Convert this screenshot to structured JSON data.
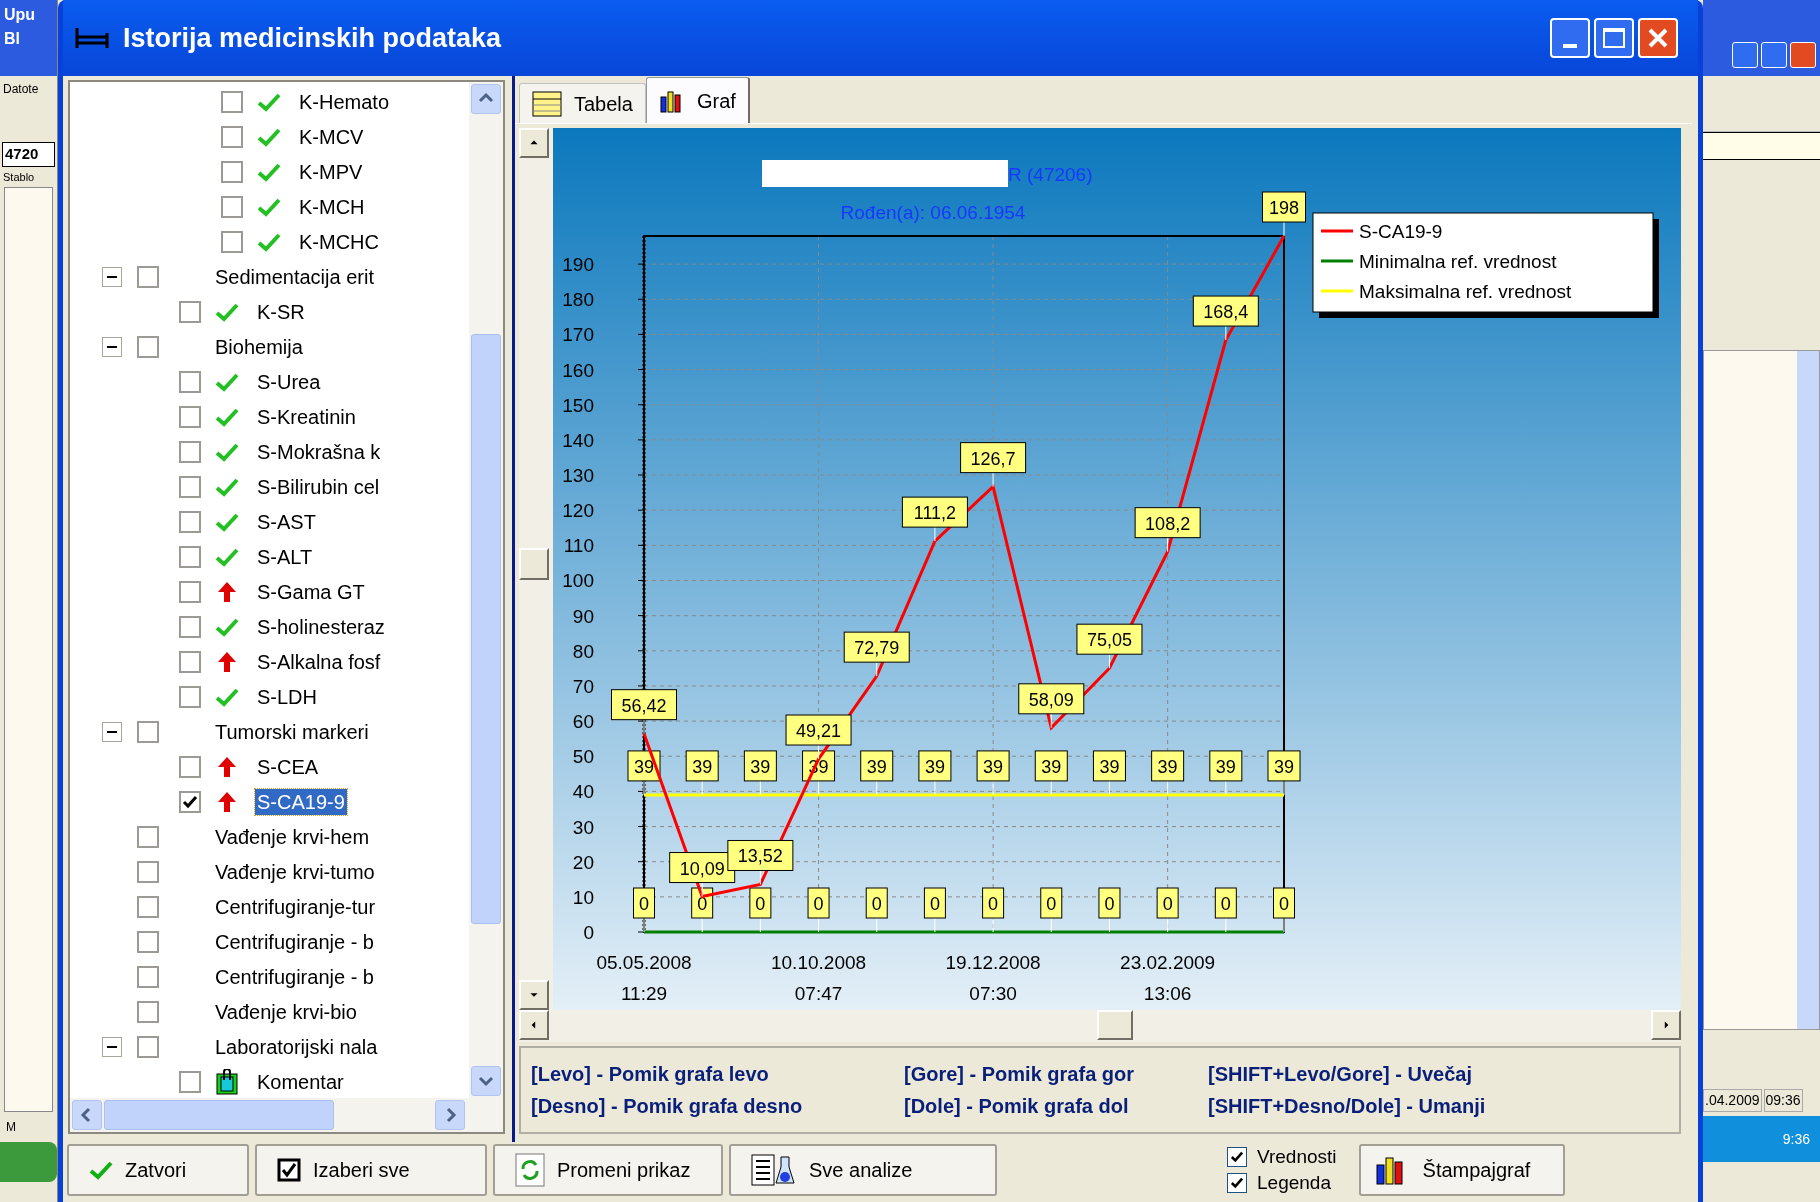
{
  "background_app": {
    "left_texts": [
      "Upu",
      "Bl",
      "Datote",
      "4720",
      "Stablo",
      "M"
    ],
    "right_texts": [
      ".04.2009",
      "09:36",
      "9:36"
    ]
  },
  "window": {
    "title": "Istorija medicinskih podataka"
  },
  "tree": {
    "upper_branch": [
      {
        "label": "K-Hemato",
        "checked": false,
        "selected": false,
        "kind": "ok"
      },
      {
        "label": "K-MCV",
        "checked": false,
        "selected": false,
        "kind": "ok"
      },
      {
        "label": "K-MPV",
        "checked": false,
        "selected": false,
        "kind": "ok"
      },
      {
        "label": "K-MCH",
        "checked": false,
        "selected": false,
        "kind": "ok"
      },
      {
        "label": "K-MCHC",
        "checked": false,
        "selected": false,
        "kind": "ok"
      }
    ],
    "items": [
      {
        "label": "Sedimentacija erit",
        "checked": false,
        "selected": false,
        "expanded": true,
        "children": [
          {
            "label": "K-SR",
            "checked": false,
            "selected": false,
            "kind": "ok"
          }
        ]
      },
      {
        "label": "Biohemija",
        "checked": false,
        "selected": false,
        "expanded": true,
        "children": [
          {
            "label": "S-Urea",
            "checked": false,
            "selected": false,
            "kind": "ok"
          },
          {
            "label": "S-Kreatinin",
            "checked": false,
            "selected": false,
            "kind": "ok"
          },
          {
            "label": "S-Mokrašna k",
            "checked": false,
            "selected": false,
            "kind": "ok"
          },
          {
            "label": "S-Bilirubin cel",
            "checked": false,
            "selected": false,
            "kind": "ok"
          },
          {
            "label": "S-AST",
            "checked": false,
            "selected": false,
            "kind": "ok"
          },
          {
            "label": "S-ALT",
            "checked": false,
            "selected": false,
            "kind": "ok"
          },
          {
            "label": "S-Gama GT",
            "checked": false,
            "selected": false,
            "kind": "high"
          },
          {
            "label": "S-holinesteraz",
            "checked": false,
            "selected": false,
            "kind": "ok"
          },
          {
            "label": "S-Alkalna fosf",
            "checked": false,
            "selected": false,
            "kind": "high"
          },
          {
            "label": "S-LDH",
            "checked": false,
            "selected": false,
            "kind": "ok"
          }
        ]
      },
      {
        "label": "Tumorski markeri",
        "checked": false,
        "selected": false,
        "expanded": true,
        "children": [
          {
            "label": "S-CEA",
            "checked": false,
            "selected": false,
            "kind": "high"
          },
          {
            "label": "S-CA19-9",
            "checked": true,
            "selected": true,
            "kind": "high"
          }
        ]
      },
      {
        "label": "Vađenje krvi-hem",
        "checked": false,
        "selected": false
      },
      {
        "label": "Vađenje krvi-tumo",
        "checked": false,
        "selected": false
      },
      {
        "label": "Centrifugiranje-tur",
        "checked": false,
        "selected": false
      },
      {
        "label": "Centrifugiranje - b",
        "checked": false,
        "selected": false
      },
      {
        "label": "Centrifugiranje - b",
        "checked": false,
        "selected": false
      },
      {
        "label": "Vađenje krvi-bio",
        "checked": false,
        "selected": false
      },
      {
        "label": "Laboratorijski nala",
        "checked": false,
        "selected": false,
        "expanded": true,
        "children": [
          {
            "label": "Komentar",
            "checked": false,
            "selected": false,
            "kind": "note"
          }
        ]
      }
    ]
  },
  "tabs": [
    {
      "label": "Tabela",
      "kind": "table",
      "selected": false
    },
    {
      "label": "Graf",
      "kind": "chart",
      "selected": true
    }
  ],
  "chart": {
    "patient_visible": "R (47206)",
    "birth": "Rođen(a): 06.06.1954",
    "chart_data": {
      "type": "line",
      "categories": [
        "05.05.2008 11:29",
        null,
        null,
        "10.10.2008 07:47",
        null,
        null,
        "19.12.2008 07:30",
        null,
        null,
        "23.02.2009 13:06",
        null,
        null
      ],
      "ylim": [
        0,
        198
      ],
      "yticks": [
        0,
        10,
        20,
        30,
        40,
        50,
        60,
        70,
        80,
        90,
        100,
        110,
        120,
        130,
        140,
        150,
        160,
        170,
        180,
        190
      ],
      "grid": true,
      "legend": true,
      "series": [
        {
          "name": "S-CA19-9",
          "color": "#ff0000",
          "values": [
            56.42,
            10.09,
            13.52,
            49.21,
            72.79,
            111.2,
            126.7,
            58.09,
            75.05,
            108.2,
            168.4,
            198
          ]
        },
        {
          "name": "Minimalna ref. vrednost",
          "color": "#008000",
          "values": [
            0,
            0,
            0,
            0,
            0,
            0,
            0,
            0,
            0,
            0,
            0,
            0
          ]
        },
        {
          "name": "Maksimalna ref. vrednost",
          "color": "#ffff00",
          "values": [
            39,
            39,
            39,
            39,
            39,
            39,
            39,
            39,
            39,
            39,
            39,
            39
          ]
        }
      ],
      "value_labels": [
        [
          "56,42",
          "10,09",
          "13,52",
          "49,21",
          "72,79",
          "111,2",
          "126,7",
          "58,09",
          "75,05",
          "108,2",
          "168,4",
          "198"
        ],
        [
          "0",
          "0",
          "0",
          "0",
          "0",
          "0",
          "0",
          "0",
          "0",
          "0",
          "0",
          "0"
        ],
        [
          "39",
          "39",
          "39",
          "39",
          "39",
          "39",
          "39",
          "39",
          "39",
          "39",
          "39",
          "39"
        ]
      ]
    }
  },
  "shortcuts": [
    "[Levo] - Pomik grafa levo",
    "[Gore] - Pomik grafa gor",
    "[SHIFT+Levo/Gore] - Uvečaj",
    "[Desno] - Pomik grafa desno",
    "[Dole] - Pomik grafa dol",
    "[SHIFT+Desno/Dole] - Umanji"
  ],
  "buttons": [
    {
      "label": "Zatvori",
      "kind": "close"
    },
    {
      "label": "Izaberi sve",
      "kind": "select_all"
    },
    {
      "label": "Promeni prikaz",
      "kind": "switch"
    },
    {
      "label": "Sve analize",
      "kind": "analyses"
    }
  ],
  "options": [
    {
      "label": "Vrednosti",
      "checked": true
    },
    {
      "label": "Legenda",
      "checked": true
    }
  ],
  "print_button": {
    "label": "Štampajgraf"
  }
}
